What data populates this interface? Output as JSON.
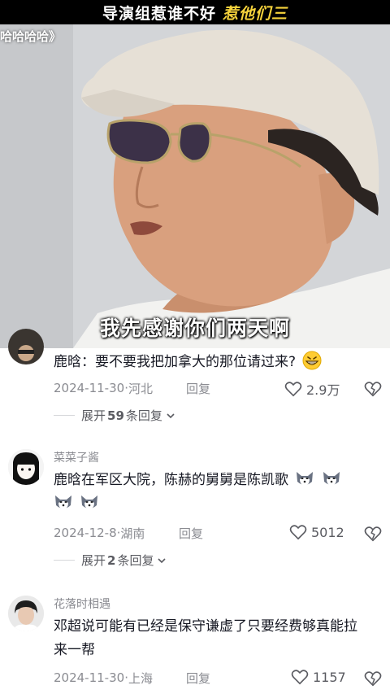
{
  "video": {
    "banner_white": "导演组惹谁不好",
    "banner_yellow": "惹他们三",
    "corner_tag": "哈哈哈哈》",
    "subtitle": "我先感谢你们两天啊",
    "colors": {
      "banner_bg": "#000000",
      "banner_accent": "#f5d23c"
    }
  },
  "comments": [
    {
      "user": "",
      "text": "鹿晗：要不要我把加拿大的那位请过来?",
      "emojis": [
        "grin-emoji"
      ],
      "date": "2024-11-30",
      "location": "河北",
      "reply_label": "回复",
      "likes": "2.9万",
      "expand": {
        "prefix": "展开",
        "count": "59",
        "suffix": "条回复"
      }
    },
    {
      "user": "菜菜子酱",
      "text": "鹿晗在军区大院，陈赫的舅舅是陈凯歌",
      "emojis": [
        "husky-emoji",
        "husky-emoji",
        "husky-emoji",
        "husky-emoji"
      ],
      "date": "2024-12-8",
      "location": "湖南",
      "reply_label": "回复",
      "likes": "5012",
      "expand": {
        "prefix": "展开",
        "count": "2",
        "suffix": "条回复"
      }
    },
    {
      "user": "花落时相遇",
      "text": "邓超说可能有已经是保守谦虚了只要经费够真能拉来一帮",
      "emojis": [],
      "date": "2024-11-30",
      "location": "上海",
      "reply_label": "回复",
      "likes": "1157"
    }
  ],
  "separator": "·"
}
